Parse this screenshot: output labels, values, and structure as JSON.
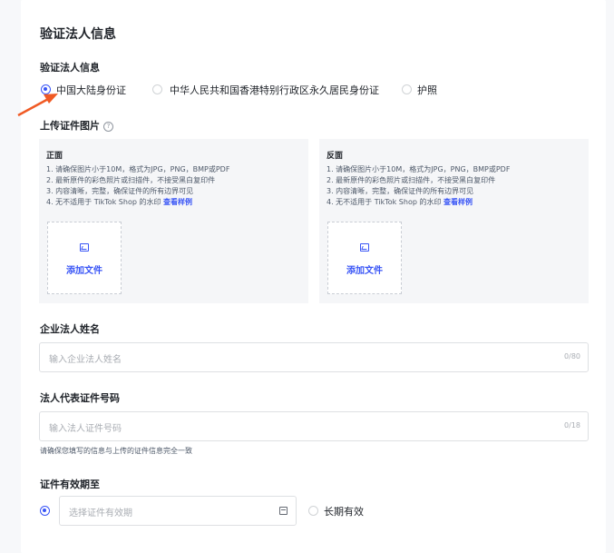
{
  "section_title": "验证法人信息",
  "verify": {
    "label": "验证法人信息",
    "options": [
      "中国大陆身份证",
      "中华人民共和国香港特别行政区永久居民身份证",
      "护照"
    ],
    "selected": "中国大陆身份证"
  },
  "upload": {
    "label": "上传证件图片",
    "help_icon": "question-circle-icon",
    "front": {
      "title": "正面",
      "lines": [
        "1. 请确保图片小于10M，格式为JPG，PNG，BMP或PDF",
        "2. 最新原件的彩色照片或扫描件，不接受黑白复印件",
        "3. 内容清晰，完整，确保证件的所有边界可见",
        "4. 无不适用于 TikTok Shop 的水印"
      ],
      "link": "查看样例",
      "button": "添加文件"
    },
    "back": {
      "title": "反面",
      "lines": [
        "1. 请确保图片小于10M，格式为JPG，PNG，BMP或PDF",
        "2. 最新原件的彩色照片或扫描件，不接受黑白复印件",
        "3. 内容清晰，完整，确保证件的所有边界可见",
        "4. 无不适用于 TikTok Shop 的水印"
      ],
      "link": "查看样例",
      "button": "添加文件"
    }
  },
  "legal_name": {
    "label": "企业法人姓名",
    "placeholder": "输入企业法人姓名",
    "counter": "0/80"
  },
  "id_number": {
    "label": "法人代表证件号码",
    "placeholder": "输入法人证件号码",
    "counter": "0/18",
    "hint": "请确保您填写的信息与上传的证件信息完全一致"
  },
  "validity": {
    "label": "证件有效期至",
    "placeholder": "选择证件有效期",
    "long_term": "长期有效",
    "selected": "date"
  },
  "colors": {
    "accent": "#3955f6",
    "arrow": "#f05a24"
  }
}
